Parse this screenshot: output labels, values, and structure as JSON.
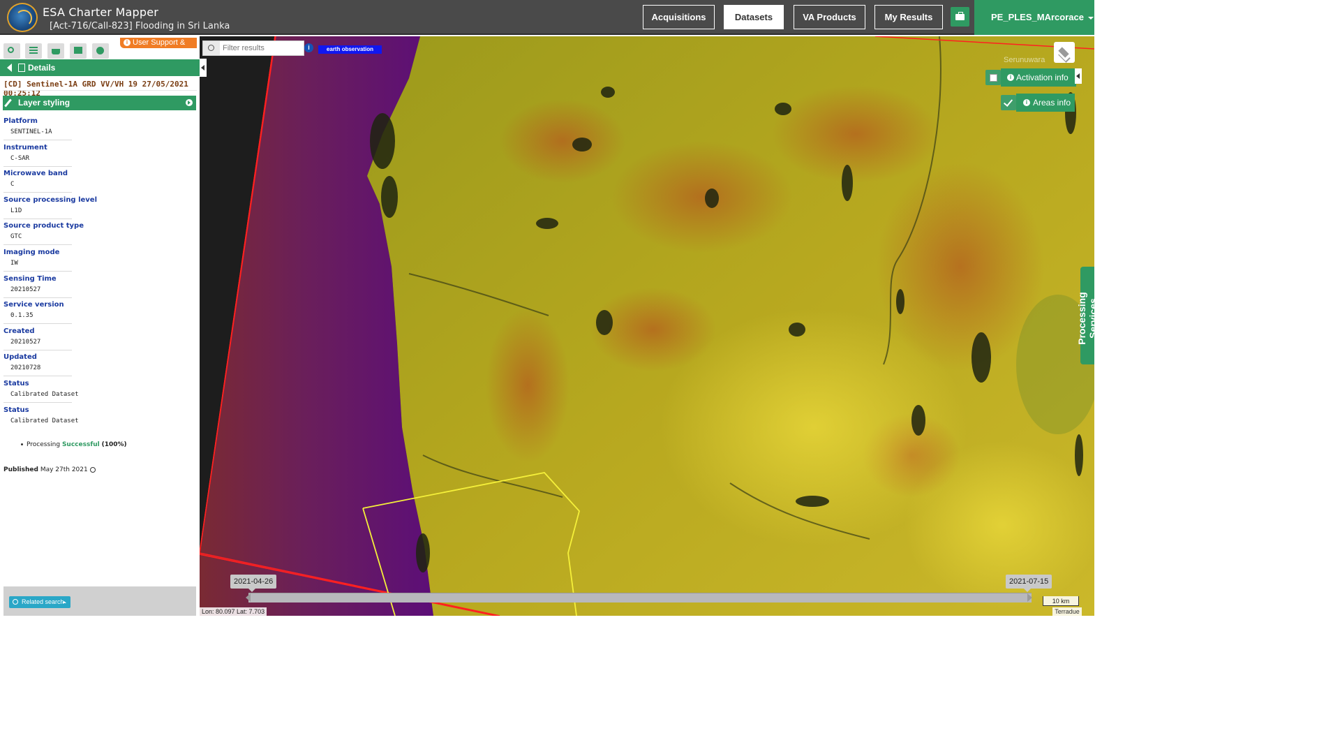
{
  "app": {
    "title": "ESA Charter Mapper",
    "subtitle": "[Act-716/Call-823] Flooding in Sri Lanka"
  },
  "nav": {
    "tabs": [
      {
        "label": "Acquisitions",
        "active": false
      },
      {
        "label": "Datasets",
        "active": true
      },
      {
        "label": "VA Products",
        "active": false
      },
      {
        "label": "My Results",
        "active": false
      }
    ],
    "tool_icon": "briefcase-icon",
    "user": "PE_PLES_MArcorace"
  },
  "sidebar": {
    "toolbar_icons": [
      "search-icon",
      "list-icon",
      "basket-icon",
      "archive-icon",
      "gear-icon"
    ],
    "support_label": "User Support & UM",
    "details_label": "Details",
    "product_title": "[CD] Sentinel-1A GRD VV/VH 19 27/05/2021 00:25:12",
    "layer_styling_label": "Layer styling",
    "properties": [
      {
        "label": "Platform",
        "value": "SENTINEL-1A"
      },
      {
        "label": "Instrument",
        "value": "C-SAR"
      },
      {
        "label": "Microwave band",
        "value": "C"
      },
      {
        "label": "Source processing level",
        "value": "L1D"
      },
      {
        "label": "Source product type",
        "value": "GTC"
      },
      {
        "label": "Imaging mode",
        "value": "IW"
      },
      {
        "label": "Sensing Time",
        "value": "20210527"
      },
      {
        "label": "Service version",
        "value": "0.1.35"
      },
      {
        "label": "Created",
        "value": "20210527"
      },
      {
        "label": "Updated",
        "value": "20210728"
      },
      {
        "label": "Status",
        "value": "Calibrated Dataset"
      },
      {
        "label": "Status",
        "value": "Calibrated Dataset"
      }
    ],
    "processing": {
      "prefix": "Processing",
      "status": "Successful",
      "percent": "(100%)"
    },
    "published": {
      "label": "Published",
      "date": "May 27th 2021"
    },
    "related_search_label": "Related search"
  },
  "map": {
    "filter_placeholder": "Filter results",
    "tag": "earth observation",
    "place_label": "Serunuwara",
    "activation_info_label": "Activation info",
    "activation_checked": false,
    "areas_info_label": "Areas info",
    "areas_checked": true,
    "processing_services_label": "Processing Services",
    "timeline": {
      "start": "2021-04-26",
      "end": "2021-07-15"
    },
    "scale": "10 km",
    "attribution": "Terradue",
    "coordinates": "Lon: 80.097 Lat: 7.703"
  },
  "colors": {
    "header_bg": "#4a4a4a",
    "accent_green": "#2f9a62",
    "support_orange": "#f07c24",
    "label_blue": "#1a3aa0",
    "tag_blue": "#1017f0",
    "footprint_red": "#ff2020",
    "aoi_yellow": "#f5f03a"
  }
}
